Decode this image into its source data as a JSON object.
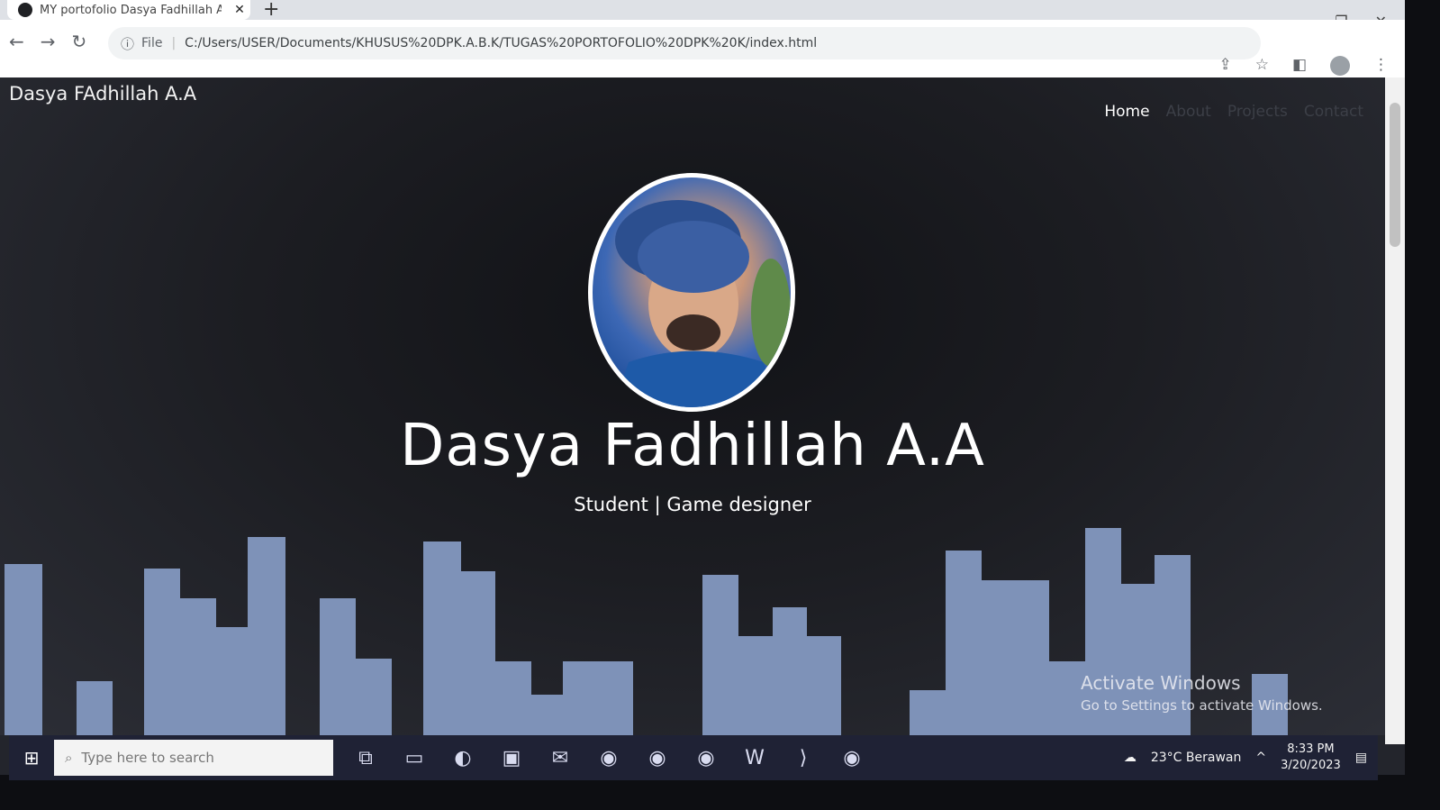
{
  "browser": {
    "tab_title": "MY portofolio Dasya Fadhillah A.A",
    "url_scheme": "File",
    "url": "C:/Users/USER/Documents/KHUSUS%20DPK.A.B.K/TUGAS%20PORTOFOLIO%20DPK%20K/index.html"
  },
  "site": {
    "brand": "Dasya FAdhillah A.A",
    "nav": [
      "Home",
      "About",
      "Projects",
      "Contact"
    ],
    "hero_name": "Dasya Fadhillah A.A",
    "hero_subtitle": "Student | Game designer"
  },
  "watermark": {
    "title": "Activate Windows",
    "subtitle": "Go to Settings to activate Windows."
  },
  "taskbar": {
    "search_placeholder": "Type here to search",
    "weather": "23°C  Berawan",
    "time": "8:33 PM",
    "date": "3/20/2023",
    "icons": [
      "task-view-icon",
      "file-explorer-icon",
      "edge-icon",
      "store-icon",
      "mail-icon",
      "chrome-icon",
      "chrome-profile-icon",
      "chrome-profile-2-icon",
      "word-icon",
      "vscode-icon",
      "chrome-active-icon"
    ]
  },
  "colors": {
    "skyline": "#7e92b8",
    "page_bg": "#1c1d22",
    "taskbar": "#1f2235"
  }
}
